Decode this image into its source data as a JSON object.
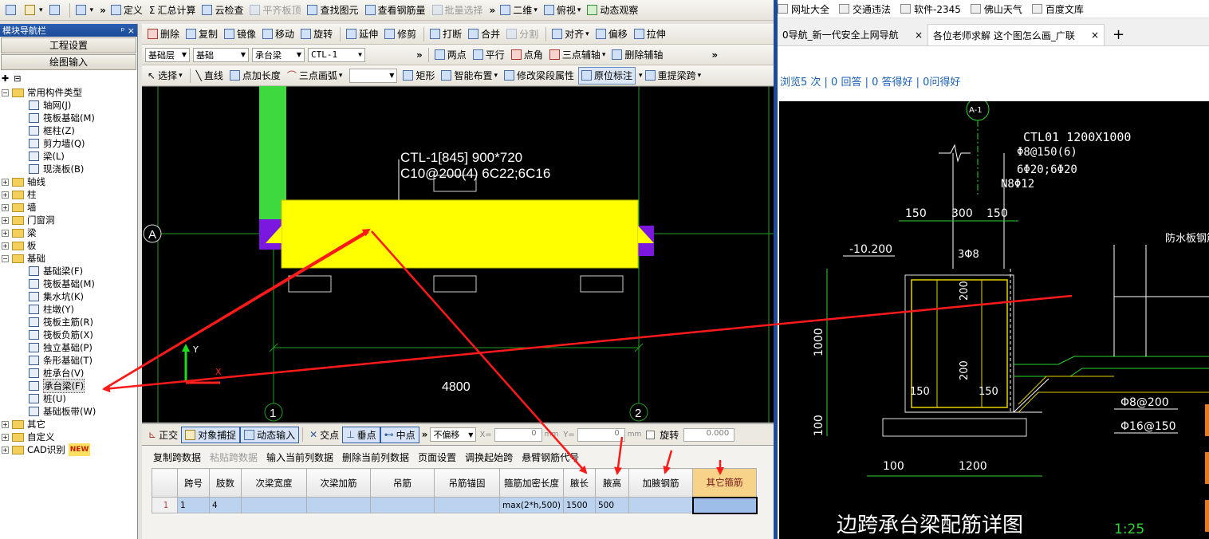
{
  "toolbar1": {
    "new": "",
    "open": "",
    "save": "",
    "undo": "",
    "define": "定义",
    "sum_calc": "汇总计算",
    "cloud_check": "云检查",
    "align_slab": "平齐板顶",
    "find_element": "查找图元",
    "view_rebar": "查看钢筋量",
    "batch_select": "批量选择",
    "view_2d": "二维",
    "view_mode": "俯视",
    "dynamic_observe": "动态观察"
  },
  "toolbar2": {
    "delete": "删除",
    "copy": "复制",
    "mirror": "镜像",
    "move": "移动",
    "rotate": "旋转",
    "extend": "延伸",
    "trim": "修剪",
    "break": "打断",
    "merge": "合并",
    "split": "分割",
    "align": "对齐",
    "offset": "偏移",
    "stretch": "拉伸"
  },
  "toolbar3": {
    "layer": "基础层",
    "category": "基础",
    "type": "承台梁",
    "name": "CTL-1",
    "two_point": "两点",
    "parallel": "平行",
    "point_angle": "点角",
    "three_point_aux": "三点辅轴",
    "delete_aux": "删除辅轴"
  },
  "toolbar4": {
    "select": "选择",
    "line": "直线",
    "point_length": "点加长度",
    "three_arc": "三点画弧",
    "rect": "矩形",
    "smart_layout": "智能布置",
    "modify_span": "修改梁段属性",
    "original_annotation": "原位标注",
    "re_extract": "重提梁跨"
  },
  "nav": {
    "title": "模块导航栏",
    "pin": "ᵖ",
    "close": "×",
    "project_settings": "工程设置",
    "drawing_input": "绘图输入",
    "tree": [
      {
        "label": "常用构件类型",
        "kind": "folder",
        "pm": "−",
        "indent": 0
      },
      {
        "label": "轴网(J)",
        "kind": "item",
        "indent": 1
      },
      {
        "label": "筏板基础(M)",
        "kind": "item",
        "indent": 1
      },
      {
        "label": "框柱(Z)",
        "kind": "item",
        "indent": 1
      },
      {
        "label": "剪力墙(Q)",
        "kind": "item",
        "indent": 1
      },
      {
        "label": "梁(L)",
        "kind": "item",
        "indent": 1
      },
      {
        "label": "现浇板(B)",
        "kind": "item",
        "indent": 1
      },
      {
        "label": "轴线",
        "kind": "folder",
        "pm": "+",
        "indent": 0
      },
      {
        "label": "柱",
        "kind": "folder",
        "pm": "+",
        "indent": 0
      },
      {
        "label": "墙",
        "kind": "folder",
        "pm": "+",
        "indent": 0
      },
      {
        "label": "门窗洞",
        "kind": "folder",
        "pm": "+",
        "indent": 0
      },
      {
        "label": "梁",
        "kind": "folder",
        "pm": "+",
        "indent": 0
      },
      {
        "label": "板",
        "kind": "folder",
        "pm": "+",
        "indent": 0
      },
      {
        "label": "基础",
        "kind": "folder",
        "pm": "−",
        "indent": 0
      },
      {
        "label": "基础梁(F)",
        "kind": "item",
        "indent": 1
      },
      {
        "label": "筏板基础(M)",
        "kind": "item",
        "indent": 1
      },
      {
        "label": "集水坑(K)",
        "kind": "item",
        "indent": 1
      },
      {
        "label": "柱墩(Y)",
        "kind": "item",
        "indent": 1
      },
      {
        "label": "筏板主筋(R)",
        "kind": "item",
        "indent": 1
      },
      {
        "label": "筏板负筋(X)",
        "kind": "item",
        "indent": 1
      },
      {
        "label": "独立基础(P)",
        "kind": "item",
        "indent": 1
      },
      {
        "label": "条形基础(T)",
        "kind": "item",
        "indent": 1
      },
      {
        "label": "桩承台(V)",
        "kind": "item",
        "indent": 1
      },
      {
        "label": "承台梁(F)",
        "kind": "item",
        "indent": 1,
        "selected": true
      },
      {
        "label": "桩(U)",
        "kind": "item",
        "indent": 1
      },
      {
        "label": "基础板带(W)",
        "kind": "item",
        "indent": 1
      },
      {
        "label": "其它",
        "kind": "folder",
        "pm": "+",
        "indent": 0
      },
      {
        "label": "自定义",
        "kind": "folder",
        "pm": "+",
        "indent": 0
      },
      {
        "label": "CAD识别",
        "kind": "folder",
        "pm": "+",
        "indent": 0,
        "badge": "NEW"
      }
    ]
  },
  "canvas": {
    "beam_label_1": "CTL-1[845] 900*720",
    "beam_label_2": "C10@200(4) 6C22;6C16",
    "axis_a": "A",
    "axis_1": "1",
    "axis_2": "2",
    "dimension": "4800",
    "y_axis": "Y",
    "x_axis": "X"
  },
  "snapbar": {
    "ortho": "正交",
    "object_snap": "对象捕捉",
    "dynamic_input": "动态输入",
    "intersection": "交点",
    "perpendicular": "垂点",
    "midpoint": "中点",
    "offset_mode": "不偏移",
    "x_label": "X=",
    "x_value": "0",
    "y_label": "Y=",
    "y_value": "0",
    "unit": "mm",
    "rotate": "旋转",
    "rotate_value": "0.000"
  },
  "span_table": {
    "toolbar": [
      "复制跨数据",
      "粘贴跨数据",
      "输入当前列数据",
      "删除当前列数据",
      "页面设置",
      "调换起始跨",
      "悬臂钢筋代号"
    ],
    "columns": [
      "跨号",
      "肢数",
      "次梁宽度",
      "次梁加筋",
      "吊筋",
      "吊筋锚固",
      "箍筋加密长度",
      "腋长",
      "腋高",
      "加腋钢筋",
      "其它箍筋"
    ],
    "rows": [
      {
        "row_no": "1",
        "cells": [
          "1",
          "4",
          "",
          "",
          "",
          "",
          "max(2*h,500)",
          "1500",
          "500",
          "",
          ""
        ]
      }
    ]
  },
  "browser": {
    "bookmarks": [
      "网址大全",
      "交通违法",
      "软件-2345",
      "佛山天气",
      "百度文库"
    ],
    "tabs": [
      {
        "title": "0导航_新一代安全上网导航",
        "close": "×"
      },
      {
        "title": "各位老师求解 这个图怎么画_广联",
        "close": "×"
      }
    ],
    "new_tab": "+",
    "stats": "浏览5 次 | 0 回答 | 0 答得好 | 0问得好"
  },
  "cad_drawing": {
    "axis_bubble": "A-1",
    "title_label": "CTL01 1200X1000",
    "spec_1": "Φ8@150(6)",
    "spec_2": "6Φ20;6Φ20",
    "spec_3": "N8Φ12",
    "dim_150a": "150",
    "dim_300": "300",
    "dim_150b": "150",
    "elevation": "-10.200",
    "label_3phi8": "3Φ8",
    "dim_1000": "1000",
    "dim_100v": "100",
    "dim_200a": "200",
    "dim_200b": "200",
    "dim_150c": "150",
    "dim_150d": "150",
    "dim_100h": "100",
    "dim_1200": "1200",
    "rebar_1": "Φ8@200",
    "rebar_2": "Φ16@150",
    "waterproof": "防水板钢筋",
    "detail_title": "边跨承台梁配筋详图",
    "scale": "1:25"
  },
  "colors": {
    "yellow_beam": "#ffff00",
    "green_column": "#3ed93e",
    "purple_support": "#7a18e0",
    "annotation_red": "#ff1a1a",
    "selection_blue": "#2a5fb0"
  }
}
